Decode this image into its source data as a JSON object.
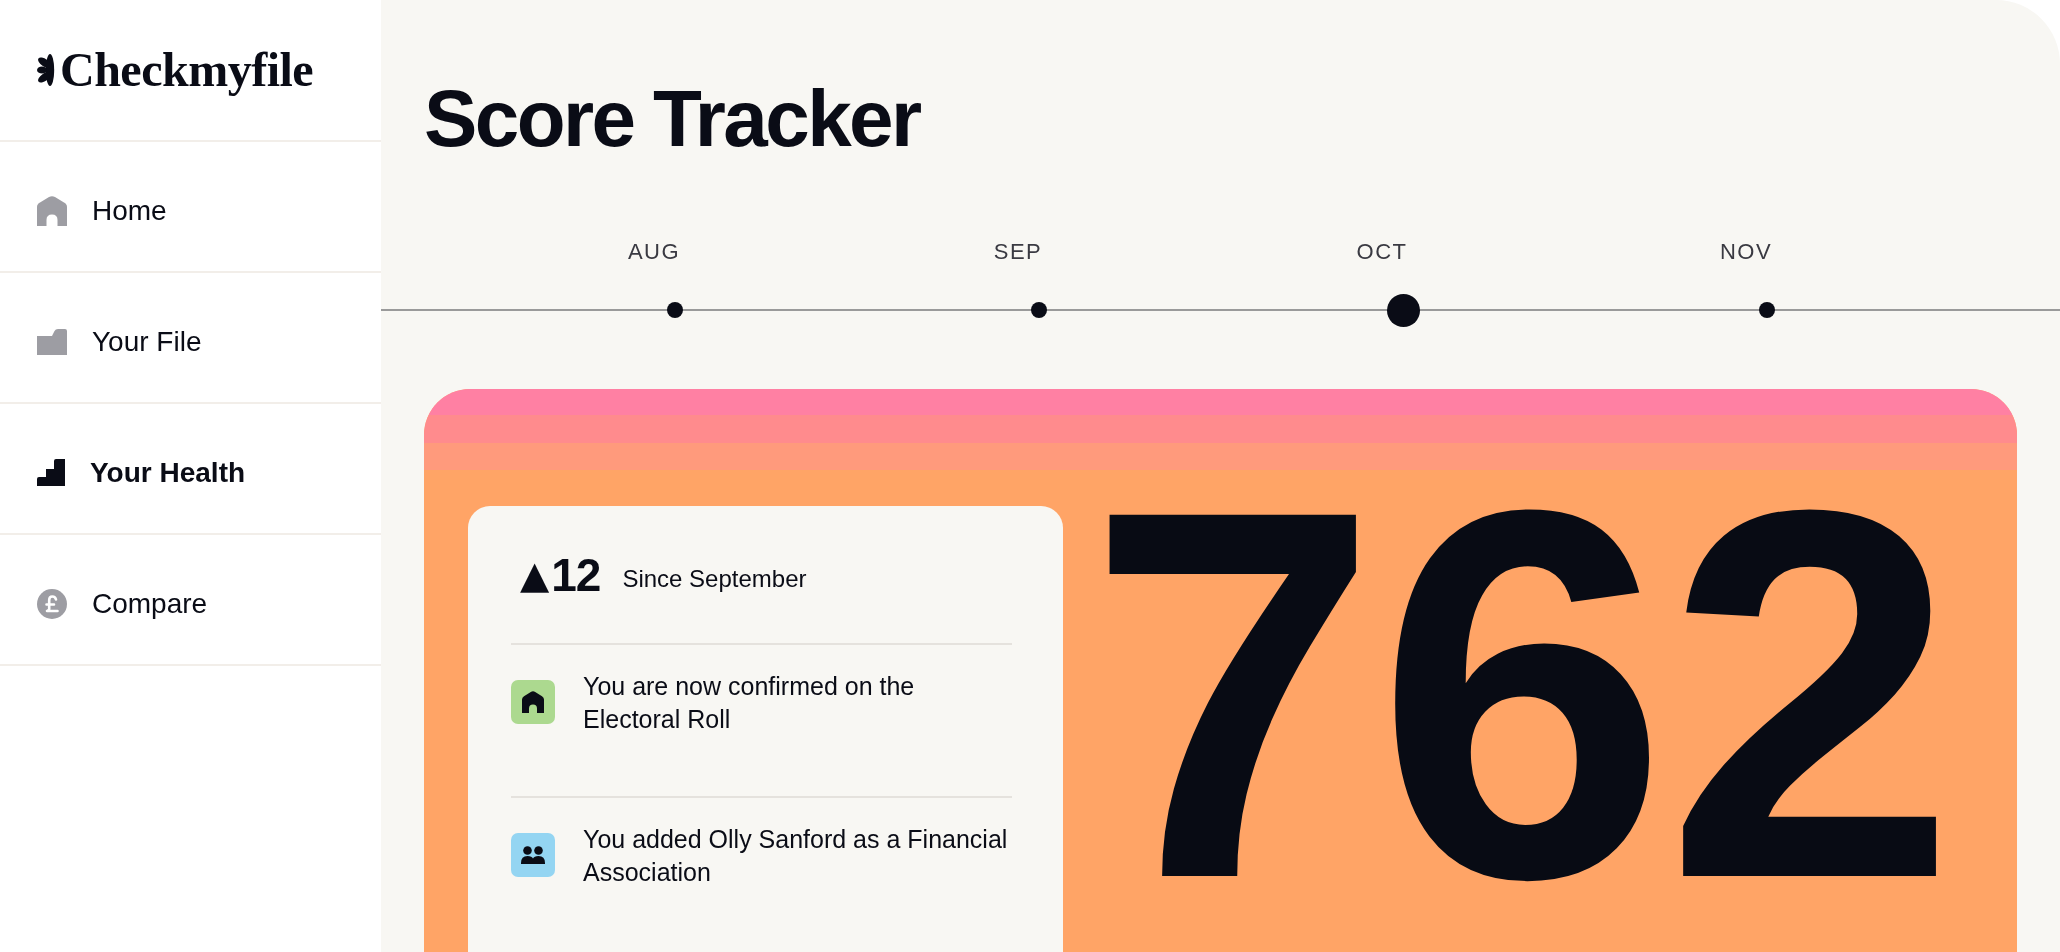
{
  "sidebar": {
    "logo": "Checkmyfile",
    "items": [
      {
        "label": "Home",
        "kind": "home",
        "selected": false
      },
      {
        "label": "Your File",
        "kind": "file",
        "selected": false
      },
      {
        "label": "Your Health",
        "kind": "health",
        "selected": true
      },
      {
        "label": "Compare",
        "kind": "compare",
        "selected": false
      }
    ]
  },
  "page": {
    "title": "Score Tracker"
  },
  "timeline": {
    "months": [
      {
        "label": "AUG",
        "selected": false
      },
      {
        "label": "SEP",
        "selected": false
      },
      {
        "label": "OCT",
        "selected": true
      },
      {
        "label": "NOV",
        "selected": false
      }
    ]
  },
  "score_card": {
    "change": {
      "arrow": "▲",
      "value": "12",
      "period": "Since September"
    },
    "events": [
      {
        "kind": "home",
        "color": "#acd98f",
        "text": "You are now confirmed on the Electoral Roll"
      },
      {
        "kind": "people",
        "color": "#94d5f2",
        "text": "You added Olly Sanford as a Financial Association"
      }
    ],
    "score": "762"
  }
}
